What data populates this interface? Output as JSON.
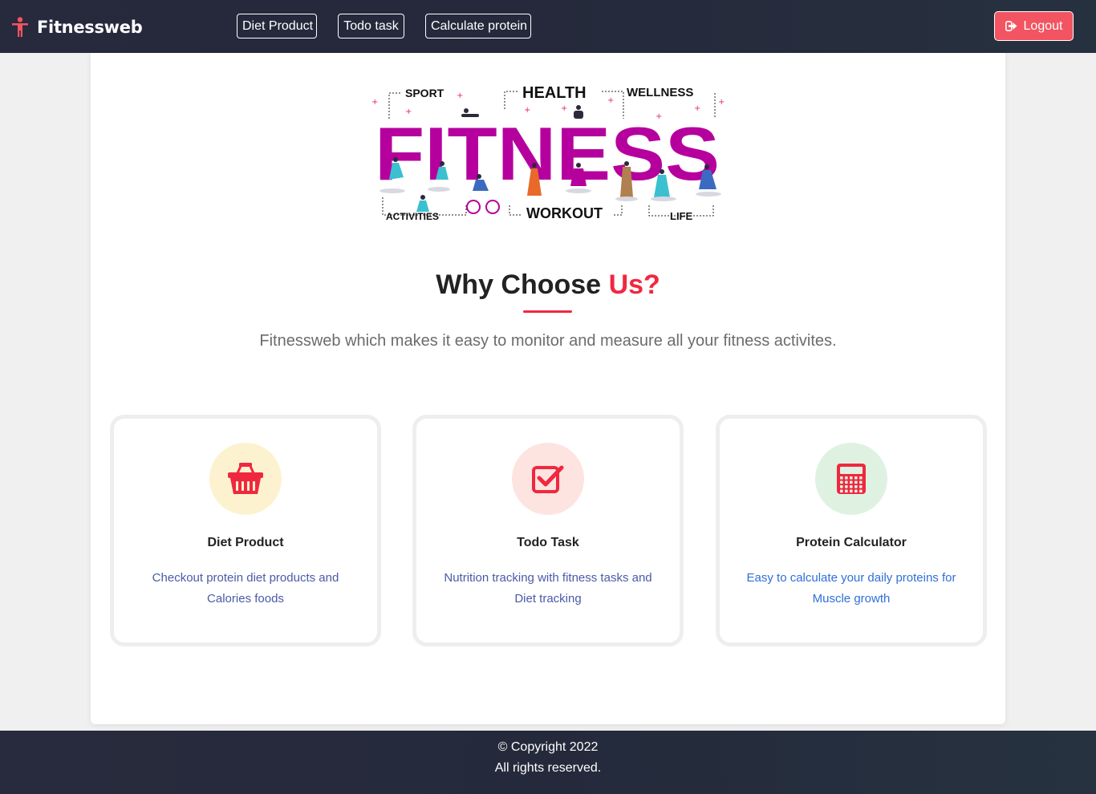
{
  "navbar": {
    "brand": "Fitnessweb",
    "links": [
      {
        "label": "Diet Product"
      },
      {
        "label": "Todo task"
      },
      {
        "label": "Calculate protein"
      }
    ],
    "logout_label": "Logout",
    "logout_color": "#f25461"
  },
  "hero": {
    "word": "FITNESS",
    "tags": [
      "SPORT",
      "HEALTH",
      "WELLNESS",
      "ACTIVITIES",
      "WORKOUT",
      "LIFE"
    ],
    "word_color": "#b5009e"
  },
  "section": {
    "title_main": "Why Choose",
    "title_accent": "Us?",
    "subtitle": "Fitnessweb which makes it easy to monitor and measure all your fitness activites.",
    "accent_color": "#f0283f"
  },
  "features": [
    {
      "title": "Diet Product",
      "description": "Checkout protein diet products and Calories foods",
      "icon": "basket-icon",
      "bg_color": "#fdf2d0",
      "desc_color": "#4a5aa8"
    },
    {
      "title": "Todo Task",
      "description": "Nutrition tracking with fitness tasks and Diet tracking",
      "icon": "checkbox-icon",
      "bg_color": "#fde4e0",
      "desc_color": "#4a5aa8"
    },
    {
      "title": "Protein Calculator",
      "description": "Easy to calculate your daily proteins for Muscle growth",
      "icon": "calculator-icon",
      "bg_color": "#dff2e2",
      "desc_color": "#2f6fd8"
    }
  ],
  "footer": {
    "copyright": "© Copyright 2022",
    "rights": "All rights reserved."
  }
}
